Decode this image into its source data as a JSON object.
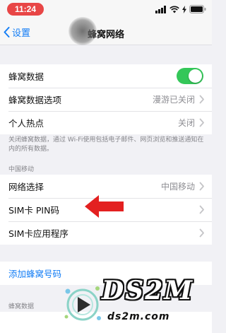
{
  "status_bar": {
    "time": "11:24"
  },
  "nav": {
    "back_label": "设置",
    "title": "蜂窝网络"
  },
  "group1": {
    "cellular_data_label": "蜂窝数据",
    "cellular_data_on": true,
    "cellular_options_label": "蜂窝数据选项",
    "cellular_options_value": "漫游已关闭",
    "hotspot_label": "个人热点",
    "hotspot_value": "关闭"
  },
  "footnote": "关闭蜂窝数据，通过 Wi-Fi使用包括电子邮件、网页浏览和推送通知在内的所有数据。",
  "carrier_section": {
    "header": "中国移动",
    "network_selection_label": "网络选择",
    "network_selection_value": "中国移动",
    "sim_pin_label": "SIM卡 PIN码",
    "sim_apps_label": "SIM卡应用程序"
  },
  "add_plan_label": "添加蜂窝号码",
  "bottom_section_header": "蜂窝数据",
  "colors": {
    "accent": "#147ef5",
    "toggle_on": "#34c759",
    "arrow": "#e32020",
    "time_pill": "#e84646"
  },
  "watermark": {
    "title": "DS2M",
    "subtitle": "ds2m.com"
  }
}
